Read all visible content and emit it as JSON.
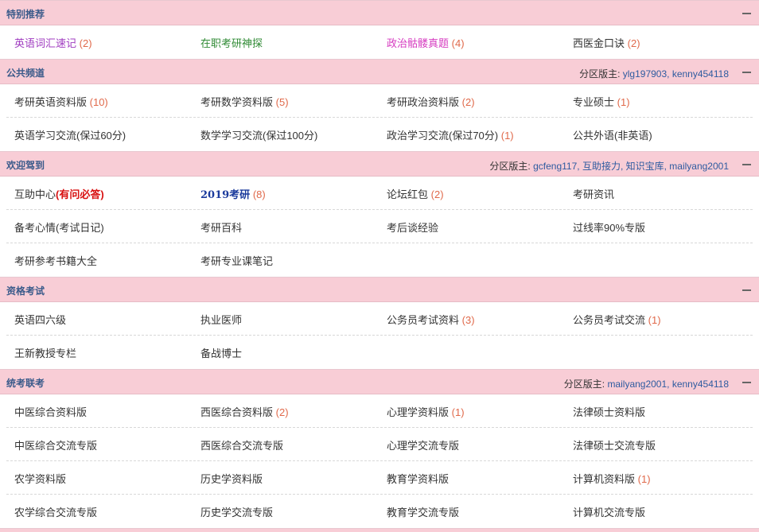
{
  "sections": [
    {
      "title": "特别推荐",
      "moderators_label": "",
      "moderators": "",
      "rows": [
        [
          {
            "name": "英语词汇速记",
            "count": "(2)",
            "style": "purple"
          },
          {
            "name": "在职考研神探",
            "count": "",
            "style": "green"
          },
          {
            "name": "政治骷髅真题",
            "count": "(4)",
            "style": "magenta"
          },
          {
            "name": "西医金口诀",
            "count": "(2)",
            "style": ""
          }
        ]
      ]
    },
    {
      "title": "公共频道",
      "moderators_label": "分区版主:",
      "moderators": "ylg197903, kenny454118",
      "rows": [
        [
          {
            "name": "考研英语资料版",
            "count": "(10)"
          },
          {
            "name": "考研数学资料版",
            "count": "(5)"
          },
          {
            "name": "考研政治资料版",
            "count": "(2)"
          },
          {
            "name": "专业硕士",
            "count": "(1)"
          }
        ],
        [
          {
            "name": "英语学习交流(保过60分)",
            "count": ""
          },
          {
            "name": "数学学习交流(保过100分)",
            "count": ""
          },
          {
            "name": "政治学习交流(保过70分)",
            "count": "(1)"
          },
          {
            "name": "公共外语(非英语)",
            "count": ""
          }
        ]
      ]
    },
    {
      "title": "欢迎驾到",
      "moderators_label": "分区版主:",
      "moderators": "gcfeng117, 互助接力, 知识宝库, mailyang2001",
      "rows": [
        [
          {
            "name": "互助中心",
            "suffix": "(有问必答)",
            "count": ""
          },
          {
            "name": "2019考研",
            "count": "(8)",
            "style": "blue-bold"
          },
          {
            "name": "论坛红包",
            "count": "(2)"
          },
          {
            "name": "考研资讯",
            "count": ""
          }
        ],
        [
          {
            "name": "备考心情(考试日记)",
            "count": ""
          },
          {
            "name": "考研百科",
            "count": ""
          },
          {
            "name": "考后谈经验",
            "count": ""
          },
          {
            "name": "过线率90%专版",
            "count": ""
          }
        ],
        [
          {
            "name": "考研参考书籍大全",
            "count": ""
          },
          {
            "name": "考研专业课笔记",
            "count": ""
          }
        ]
      ]
    },
    {
      "title": "资格考试",
      "moderators_label": "",
      "moderators": "",
      "rows": [
        [
          {
            "name": "英语四六级",
            "count": ""
          },
          {
            "name": "执业医师",
            "count": ""
          },
          {
            "name": "公务员考试资料",
            "count": "(3)"
          },
          {
            "name": "公务员考试交流",
            "count": "(1)"
          }
        ],
        [
          {
            "name": "王新教授专栏",
            "count": ""
          },
          {
            "name": "备战博士",
            "count": ""
          }
        ]
      ]
    },
    {
      "title": "统考联考",
      "moderators_label": "分区版主:",
      "moderators": "mailyang2001, kenny454118",
      "rows": [
        [
          {
            "name": "中医综合资料版",
            "count": ""
          },
          {
            "name": "西医综合资料版",
            "count": "(2)"
          },
          {
            "name": "心理学资料版",
            "count": "(1)"
          },
          {
            "name": "法律硕士资料版",
            "count": ""
          }
        ],
        [
          {
            "name": "中医综合交流专版",
            "count": ""
          },
          {
            "name": "西医综合交流专版",
            "count": ""
          },
          {
            "name": "心理学交流专版",
            "count": ""
          },
          {
            "name": "法律硕士交流专版",
            "count": ""
          }
        ],
        [
          {
            "name": "农学资料版",
            "count": ""
          },
          {
            "name": "历史学资料版",
            "count": ""
          },
          {
            "name": "教育学资料版",
            "count": ""
          },
          {
            "name": "计算机资料版",
            "count": "(1)"
          }
        ],
        [
          {
            "name": "农学综合交流专版",
            "count": ""
          },
          {
            "name": "历史学交流专版",
            "count": ""
          },
          {
            "name": "教育学交流专版",
            "count": ""
          },
          {
            "name": "计算机交流专版",
            "count": ""
          }
        ]
      ]
    }
  ]
}
